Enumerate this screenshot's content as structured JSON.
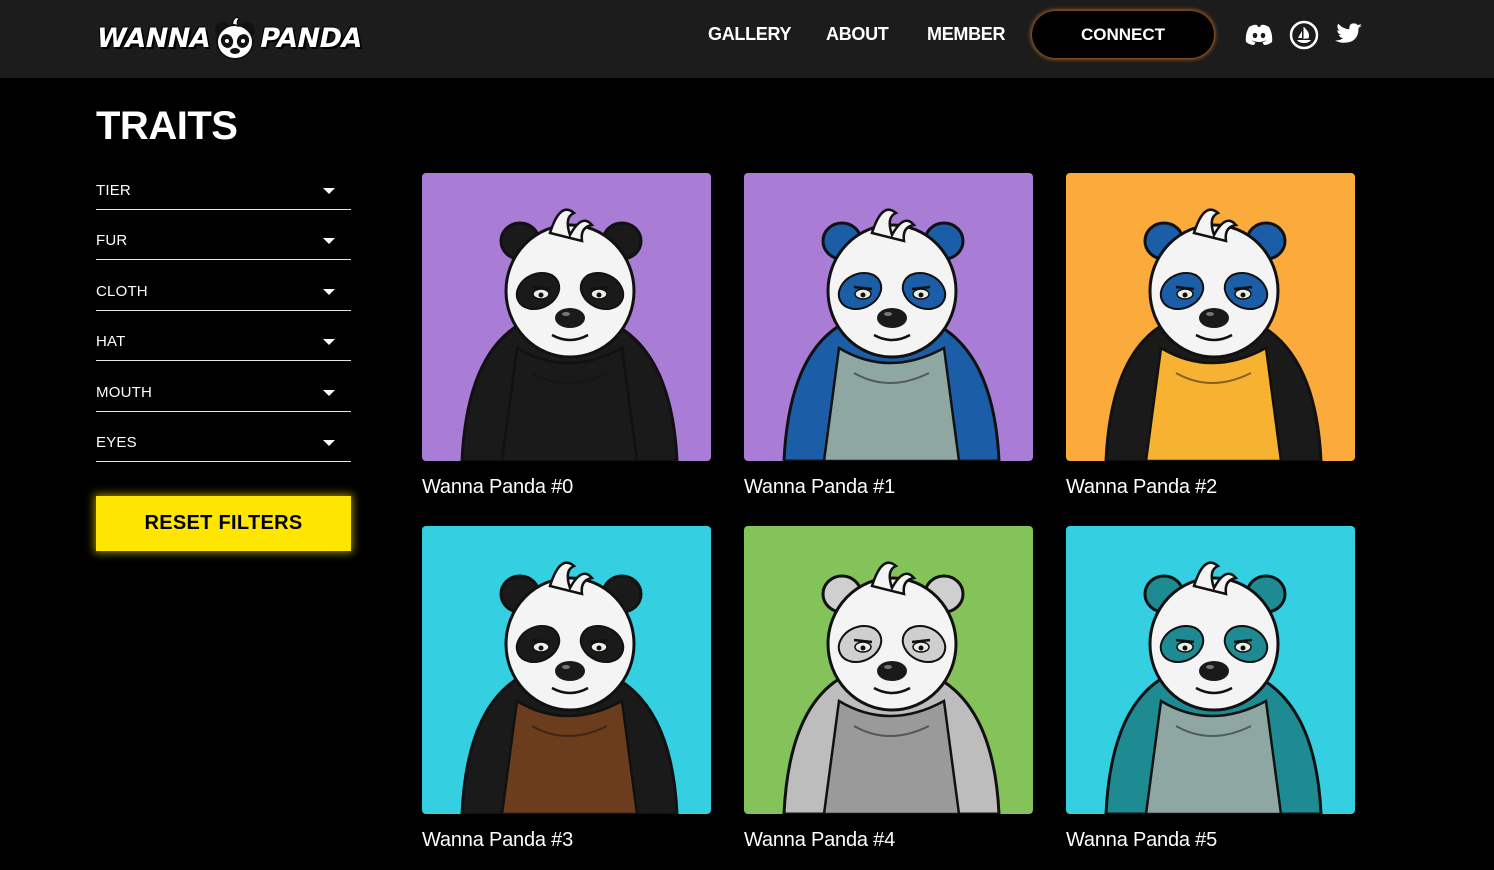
{
  "header": {
    "logo_left": "WANNA",
    "logo_right": "PANDA",
    "nav": [
      "GALLERY",
      "ABOUT",
      "MEMBER"
    ],
    "connect_label": "CONNECT",
    "social_icons": [
      "discord-icon",
      "opensea-icon",
      "twitter-icon"
    ]
  },
  "sidebar": {
    "title": "TRAITS",
    "filters": [
      "TIER",
      "FUR",
      "CLOTH",
      "HAT",
      "MOUTH",
      "EYES"
    ],
    "reset_label": "RESET FILTERS"
  },
  "gallery": {
    "items": [
      {
        "name": "Wanna Panda #0",
        "bg": "#a97cd6",
        "fur": "#1a1a1a",
        "patch": "#1a1a1a",
        "cloth": "#1a1a1a"
      },
      {
        "name": "Wanna Panda #1",
        "bg": "#a97cd6",
        "fur": "#1c5da8",
        "patch": "#1c5da8",
        "cloth": "#8fa7a3"
      },
      {
        "name": "Wanna Panda #2",
        "bg": "#fbab3b",
        "fur": "#1a1a1a",
        "patch": "#1c5da8",
        "cloth": "#f7b231"
      },
      {
        "name": "Wanna Panda #3",
        "bg": "#35cfe2",
        "fur": "#1a1a1a",
        "patch": "#1a1a1a",
        "cloth": "#6b3d1c"
      },
      {
        "name": "Wanna Panda #4",
        "bg": "#84c25a",
        "fur": "#bdbdbd",
        "patch": "#cfcfcf",
        "cloth": "#9a9a9a"
      },
      {
        "name": "Wanna Panda #5",
        "bg": "#35cfe2",
        "fur": "#1e8a91",
        "patch": "#1e8a91",
        "cloth": "#8fa7a3"
      }
    ]
  },
  "colors": {
    "header_bg": "#1c1c1c",
    "page_bg": "#000000",
    "reset_bg": "#ffe600",
    "connect_glow": "#c06a20"
  }
}
